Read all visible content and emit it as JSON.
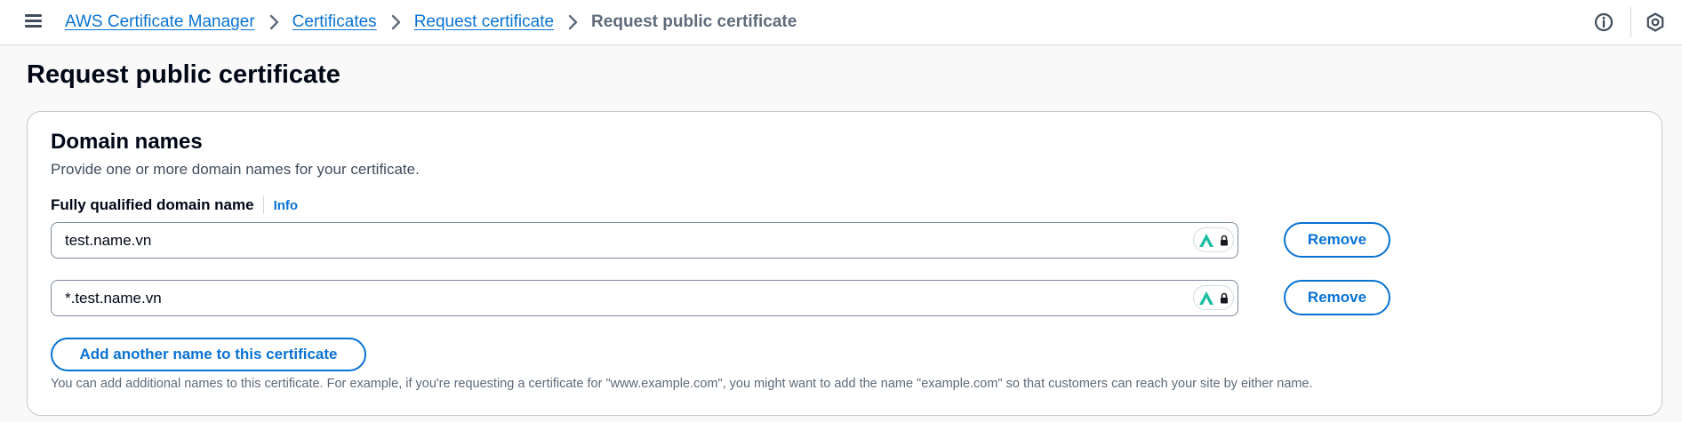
{
  "header": {
    "breadcrumbs": [
      {
        "label": "AWS Certificate Manager"
      },
      {
        "label": "Certificates"
      },
      {
        "label": "Request certificate"
      }
    ],
    "current_page": "Request public certificate",
    "icons": [
      "menu-icon",
      "chevron-right-icon",
      "info-icon",
      "settings-icon"
    ]
  },
  "page": {
    "title": "Request public certificate"
  },
  "domain_section": {
    "title": "Domain names",
    "description": "Provide one or more domain names for your certificate.",
    "field_label": "Fully qualified domain name",
    "info_label": "Info",
    "domains": [
      {
        "value": "test.name.vn",
        "remove_label": "Remove"
      },
      {
        "value": "*.test.name.vn",
        "remove_label": "Remove"
      }
    ],
    "add_button_label": "Add another name to this certificate",
    "helper_text": "You can add additional names to this certificate. For example, if you're requesting a certificate for \"www.example.com\", you might want to add the name \"example.com\" so that customers can reach your site by either name."
  },
  "colors": {
    "accent": "#0972d3",
    "heading": "#000716",
    "muted": "#5f6b7a",
    "border": "#7d8998",
    "background": "#f9f9f9"
  }
}
